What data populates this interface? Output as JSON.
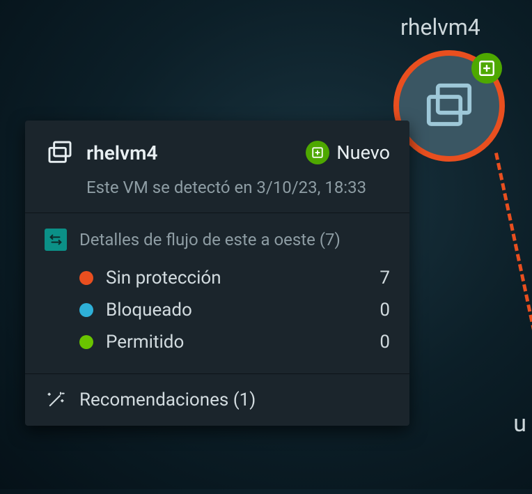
{
  "node": {
    "label": "rhelvm4"
  },
  "card": {
    "title": "rhelvm4",
    "new_label": "Nuevo",
    "subtitle": "Este VM se detectó en 3/10/23, 18:33",
    "flow": {
      "heading": "Detalles de flujo de este a oeste (7)",
      "items": [
        {
          "label": "Sin protección",
          "value": "7",
          "color": "red"
        },
        {
          "label": "Bloqueado",
          "value": "0",
          "color": "blue"
        },
        {
          "label": "Permitido",
          "value": "0",
          "color": "green"
        }
      ]
    },
    "recommendations": {
      "label": "Recomendaciones (1)"
    }
  },
  "stray": {
    "u": "u"
  }
}
